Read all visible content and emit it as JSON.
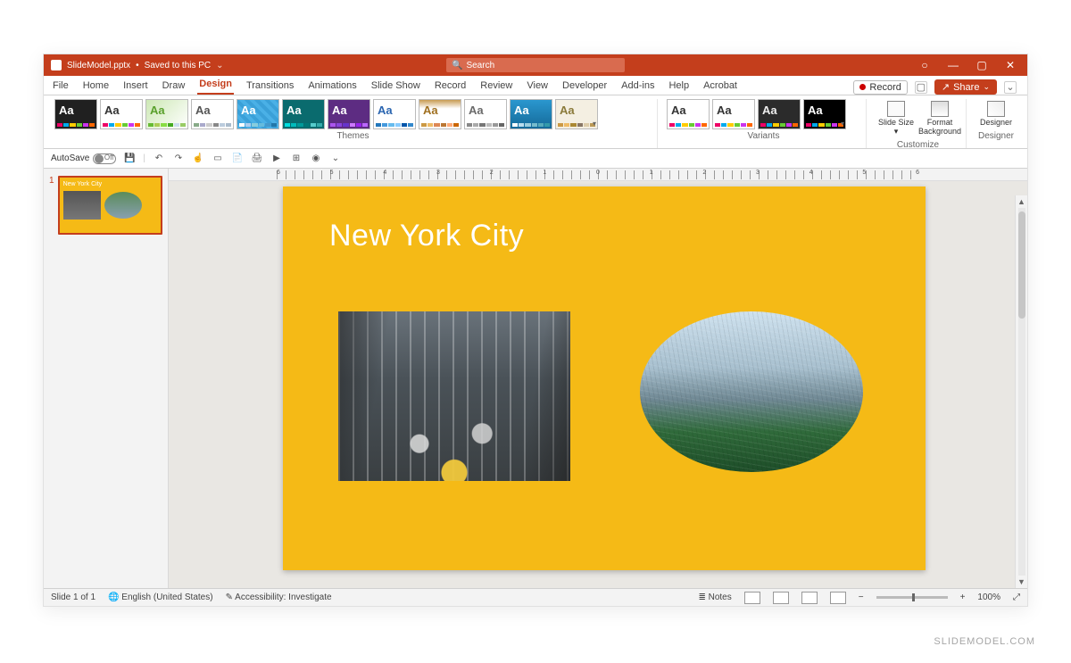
{
  "title": {
    "filename": "SlideModel.pptx",
    "save_state": "Saved to this PC"
  },
  "search": {
    "placeholder": "Search"
  },
  "window_controls": {
    "min": "—",
    "max": "▢",
    "close": "✕",
    "user": "○"
  },
  "menu": {
    "tabs": [
      "File",
      "Home",
      "Insert",
      "Draw",
      "Design",
      "Transitions",
      "Animations",
      "Slide Show",
      "Record",
      "Review",
      "View",
      "Developer",
      "Add-ins",
      "Help",
      "Acrobat"
    ],
    "active": "Design",
    "record": "Record",
    "share": "Share"
  },
  "ribbon": {
    "groups": {
      "themes": "Themes",
      "variants": "Variants",
      "customize": "Customize",
      "designer": "Designer"
    },
    "customize": {
      "slide_size": "Slide Size",
      "format_bg": "Format Background"
    },
    "designer_btn": "Designer",
    "themes": [
      {
        "bg": "#202020",
        "fg": "#ffffff",
        "cols": [
          "#e06",
          "#0ae",
          "#fc0",
          "#6c3",
          "#c3e",
          "#f60"
        ]
      },
      {
        "bg": "#ffffff",
        "fg": "#333333",
        "cols": [
          "#e06",
          "#0ae",
          "#fc0",
          "#6c3",
          "#c3e",
          "#f60"
        ]
      },
      {
        "bg": "#ffffff",
        "fg": "#5aa02c",
        "cols": [
          "#6b3",
          "#ac5",
          "#8d4",
          "#4a2",
          "#cde",
          "#9c6"
        ],
        "accent": "linear-gradient(135deg,#cde8b5,#fff)"
      },
      {
        "bg": "#ffffff",
        "fg": "#555555",
        "cols": [
          "#8a8",
          "#aac",
          "#ccc",
          "#888",
          "#bcd",
          "#abc"
        ]
      },
      {
        "bg": "#3aa0d8",
        "fg": "#ffffff",
        "cols": [
          "#fff",
          "#ace",
          "#8cd",
          "#6bd",
          "#49c",
          "#27a"
        ],
        "pattern": "repeating-linear-gradient(45deg,#4ab0e6 0 4px,#3aa0d8 4px 8px)"
      },
      {
        "bg": "#0a6b6e",
        "fg": "#ffffff",
        "cols": [
          "#0dd",
          "#0bb",
          "#099",
          "#077",
          "#5cc",
          "#3aa"
        ]
      },
      {
        "bg": "#5d2c82",
        "fg": "#ffffff",
        "cols": [
          "#a5e",
          "#84d",
          "#63c",
          "#c7f",
          "#92e",
          "#b6f"
        ]
      },
      {
        "bg": "#ffffff",
        "fg": "#2a65b0",
        "cols": [
          "#27b",
          "#49d",
          "#6be",
          "#8cf",
          "#05a",
          "#38c"
        ]
      },
      {
        "bg": "#ffffff",
        "fg": "#a07020",
        "cols": [
          "#c94",
          "#eb6",
          "#d85",
          "#b73",
          "#fa7",
          "#c60"
        ],
        "accent": "linear-gradient(#c89b52,#fff 30%)"
      },
      {
        "bg": "#ffffff",
        "fg": "#6a6a6a",
        "cols": [
          "#888",
          "#aaa",
          "#777",
          "#bbb",
          "#999",
          "#666"
        ]
      },
      {
        "bg": "#1e88c0",
        "fg": "#ffffff",
        "cols": [
          "#fff",
          "#bde",
          "#9cd",
          "#7bc",
          "#5ab",
          "#39a"
        ],
        "accent": "linear-gradient(180deg,#2a97cf,#156a99)"
      },
      {
        "bg": "#f4efe2",
        "fg": "#8a7a3a",
        "cols": [
          "#c94",
          "#eb6",
          "#a83",
          "#876",
          "#dca",
          "#b95"
        ]
      }
    ],
    "variants": [
      {
        "bg": "#ffffff",
        "fg": "#333333"
      },
      {
        "bg": "#ffffff",
        "fg": "#333333"
      },
      {
        "bg": "#2b2b2b",
        "fg": "#eeeeee"
      },
      {
        "bg": "#000000",
        "fg": "#ffffff"
      }
    ],
    "variant_cols": [
      "#e06",
      "#0ae",
      "#fc0",
      "#6c3",
      "#c3e",
      "#f60"
    ]
  },
  "qat": {
    "autosave": "AutoSave",
    "autosave_state": "Off",
    "icons": [
      "save",
      "undo",
      "redo",
      "touch",
      "new",
      "open",
      "print",
      "present",
      "grid",
      "cameo",
      "dropdown"
    ]
  },
  "ruler": {
    "labels": [
      "6",
      "5",
      "4",
      "3",
      "2",
      "1",
      "0",
      "1",
      "2",
      "3",
      "4",
      "5",
      "6"
    ]
  },
  "slide_panel": {
    "number": "1"
  },
  "slide": {
    "title": "New York City",
    "bg": "#F5BA16",
    "image1_alt": "NYC street traffic",
    "image2_alt": "Aerial skyline with park"
  },
  "status": {
    "slide_counter": "Slide 1 of 1",
    "language": "English (United States)",
    "accessibility": "Accessibility: Investigate",
    "notes": "Notes",
    "zoom": "100%"
  },
  "watermark": "SLIDEMODEL.COM"
}
